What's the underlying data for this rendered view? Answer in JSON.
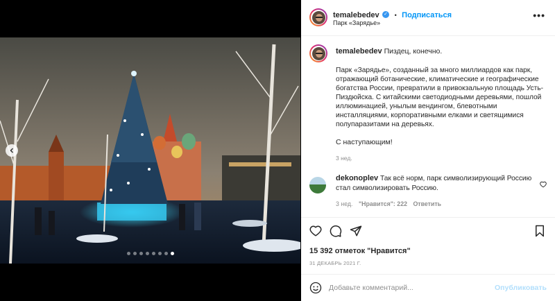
{
  "post": {
    "username": "temalebedev",
    "verified_icon": "verified-check-icon",
    "follow_label": "Подписаться",
    "separator": "•",
    "location": "Парк «Зарядье»",
    "more_icon": "more-horizontal-icon"
  },
  "caption": {
    "username": "temalebedev",
    "first_line": "Пиздец, конечно.",
    "body": "Парк «Зарядье», созданный за много миллиардов как парк, отражающий ботанические, климатические и географические богатства России, превратили в привокзальную площадь Усть-Пиздюйска. С китайскими светодиодными деревьями, пошлой иллюминацией, унылым вендингом, блевотными инсталляциями, корпоративными елками и светящимися полупаразитами на деревьях.",
    "greeting": "С наступающим!",
    "time": "3 нед."
  },
  "comment": {
    "username": "dekonoplev",
    "text": "Так всё норм, парк символизирующий Россию стал символизировать Россию.",
    "time": "3 нед.",
    "likes_label": "\"Нравится\": 222",
    "reply_label": "Ответить"
  },
  "actions": {
    "likes": "15 392 отметок \"Нравится\"",
    "date": "31 ДЕКАБРЬ 2021 Г."
  },
  "add_comment": {
    "placeholder": "Добавьте комментарий...",
    "publish_label": "Опубликовать"
  },
  "carousel": {
    "slide_count": 8,
    "active_index": 7
  },
  "colors": {
    "link": "#0095f6",
    "publish_disabled": "#b2dffc",
    "muted": "#8e8e8e",
    "verified": "#3897f0"
  }
}
